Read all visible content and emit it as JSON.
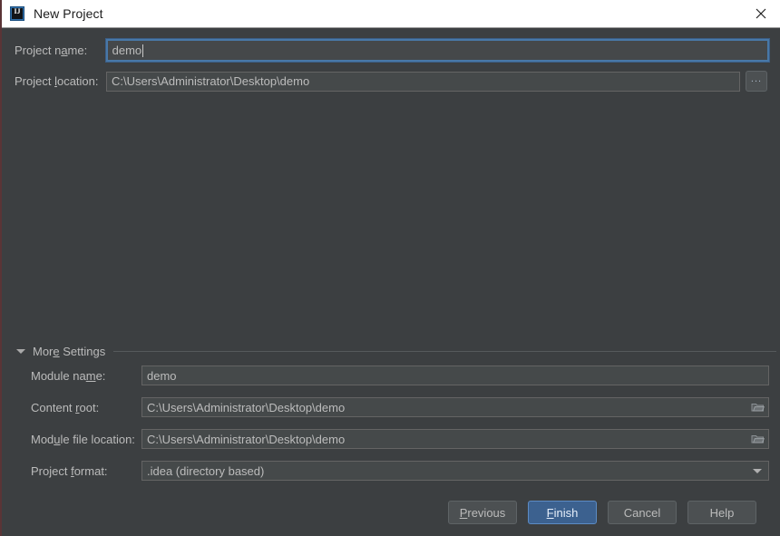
{
  "window": {
    "title": "New Project",
    "app_icon": "intellij-idea-icon",
    "close_icon": "close-icon"
  },
  "top_fields": {
    "project_name": {
      "label_before": "Project n",
      "label_mnemonic": "a",
      "label_after": "me:",
      "value": "demo",
      "focused": true
    },
    "project_location": {
      "label_before": "Project ",
      "label_mnemonic": "l",
      "label_after": "ocation:",
      "value": "C:\\Users\\Administrator\\Desktop\\demo",
      "browse_label": "..."
    }
  },
  "more_settings": {
    "label_before": "Mor",
    "label_mnemonic": "e",
    "label_after": " Settings",
    "expanded": true,
    "toggle_icon": "chevron-down-icon"
  },
  "settings_fields": [
    {
      "name": "module-name",
      "label_before": "Module na",
      "label_mnemonic": "m",
      "label_after": "e:",
      "value": "demo",
      "has_folder_icon": false,
      "type": "text"
    },
    {
      "name": "content-root",
      "label_before": "Content ",
      "label_mnemonic": "r",
      "label_after": "oot:",
      "value": "C:\\Users\\Administrator\\Desktop\\demo",
      "has_folder_icon": true,
      "type": "text"
    },
    {
      "name": "module-file-location",
      "label_before": "Mod",
      "label_mnemonic": "u",
      "label_after": "le file location:",
      "value": "C:\\Users\\Administrator\\Desktop\\demo",
      "has_folder_icon": true,
      "type": "text"
    },
    {
      "name": "project-format",
      "label_before": "Project ",
      "label_mnemonic": "f",
      "label_after": "ormat:",
      "value": ".idea (directory based)",
      "has_folder_icon": false,
      "type": "combo"
    }
  ],
  "buttons": [
    {
      "name": "previous",
      "before": "",
      "mnemonic": "P",
      "after": "revious",
      "primary": false
    },
    {
      "name": "finish",
      "before": "",
      "mnemonic": "F",
      "after": "inish",
      "primary": true
    },
    {
      "name": "cancel",
      "before": "Cancel",
      "mnemonic": "",
      "after": "",
      "primary": false
    },
    {
      "name": "help",
      "before": "Help",
      "mnemonic": "",
      "after": "",
      "primary": false
    }
  ],
  "colors": {
    "dialog_background": "#3c3f41",
    "titlebar_background": "#ffffff",
    "field_background": "#45494a",
    "accent_focus_border": "#4878a8",
    "primary_button": "#3c618f",
    "text": "#bbbbbb"
  }
}
